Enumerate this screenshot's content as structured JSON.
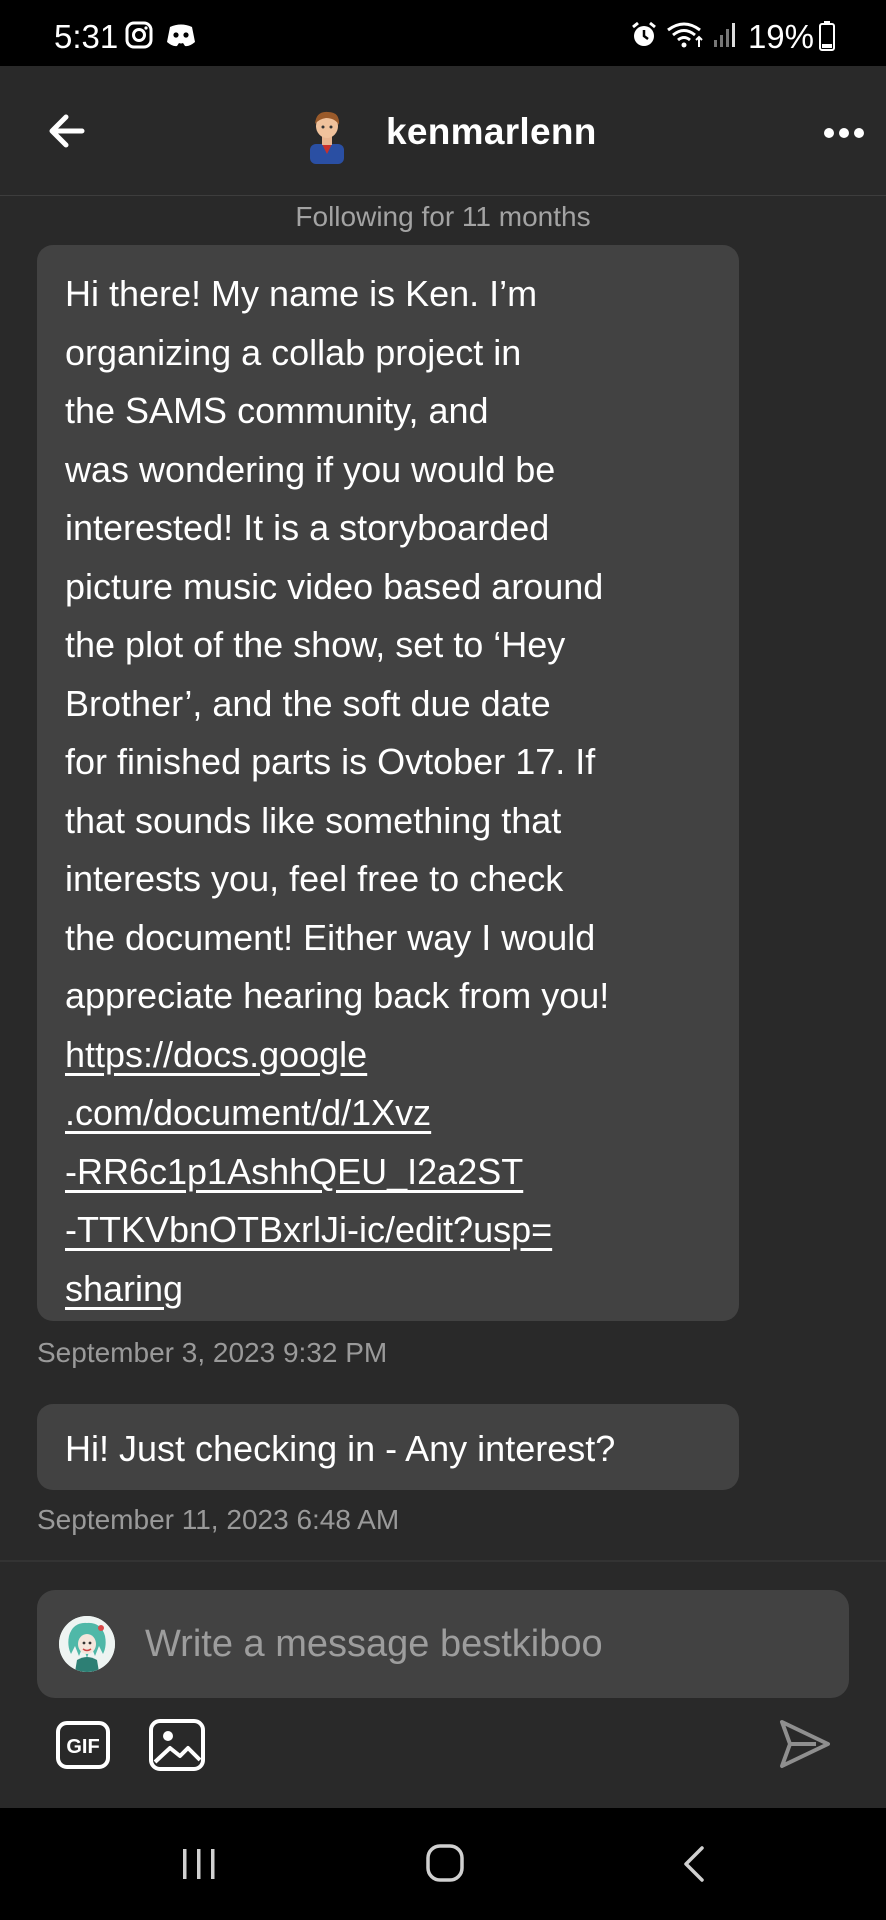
{
  "status_bar": {
    "time": "5:31",
    "battery": "19%",
    "left_icons": [
      "instagram-icon",
      "discord-icon"
    ],
    "right_icons": [
      "alarm-icon",
      "wifi-icon",
      "signal-icon",
      "battery-icon"
    ]
  },
  "header": {
    "username": "kenmarlenn",
    "back_icon": "back-arrow-icon",
    "more_icon": "more-dots-icon"
  },
  "chat": {
    "following_text": "Following for 11 months",
    "messages": [
      {
        "lines": [
          "Hi there! My name is Ken. I’m",
          "organizing a collab project in",
          "the SAMS community, and",
          "was wondering if you would be",
          "interested! It is a storyboarded",
          "picture music video based around",
          "the plot of the show, set to ‘Hey",
          "Brother’, and the soft due date",
          "for finished parts is Ovtober 17. If",
          "that sounds like something that",
          "interests you, feel free to check",
          "the document! Either way I would",
          "appreciate hearing back from you!"
        ],
        "link_lines": [
          "https://docs.google",
          ".com/document/d/1Xvz",
          "-RR6c1p1AshhQEU_I2a2ST",
          "-TTKVbnOTBxrlJi-ic/edit?usp=",
          "sharing"
        ],
        "timestamp": "September 3, 2023 9:32 PM"
      },
      {
        "text": "Hi! Just checking in - Any interest?",
        "timestamp": "September 11, 2023 6:48 AM"
      }
    ]
  },
  "composer": {
    "placeholder": "Write a message bestkiboo",
    "gif_label": "GIF",
    "icons": [
      "gif-icon",
      "image-icon",
      "send-icon"
    ]
  },
  "nav_bar": {
    "icons": [
      "recents-icon",
      "home-icon",
      "back-icon"
    ]
  },
  "colors": {
    "background": "#292929",
    "bubble": "#424242",
    "secondary_text": "#9a9a9a",
    "bars": "#000000"
  }
}
